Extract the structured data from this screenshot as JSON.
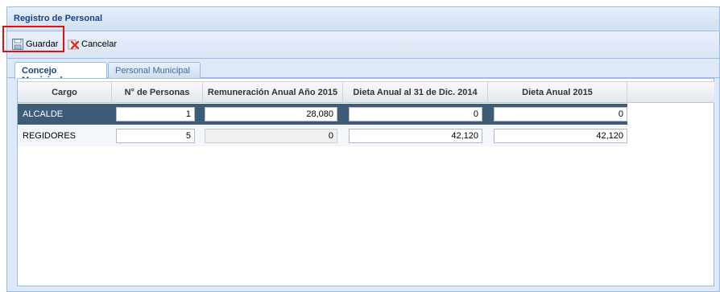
{
  "window": {
    "title": "Registro de Personal"
  },
  "toolbar": {
    "save_label": "Guardar",
    "cancel_label": "Cancelar"
  },
  "tabs": [
    {
      "label": "Concejo Municipal",
      "active": true
    },
    {
      "label": "Personal Municipal",
      "active": false
    }
  ],
  "grid": {
    "columns": [
      "Cargo",
      "N° de Personas",
      "Remuneración Anual Año 2015",
      "Dieta Anual al 31 de Dic. 2014",
      "Dieta Anual 2015"
    ],
    "rows": [
      {
        "cargo": "ALCALDE",
        "personas": "1",
        "remuneracion": "28,080",
        "dieta_2014": "0",
        "dieta_2015": "0",
        "selected": true
      },
      {
        "cargo": "REGIDORES",
        "personas": "5",
        "remuneracion": "0",
        "dieta_2014": "42,120",
        "dieta_2015": "42,120",
        "selected": false
      }
    ]
  },
  "colors": {
    "header_bg": "#dfe8f6",
    "selected_row": "#3c5c78",
    "highlight": "#e01010"
  }
}
